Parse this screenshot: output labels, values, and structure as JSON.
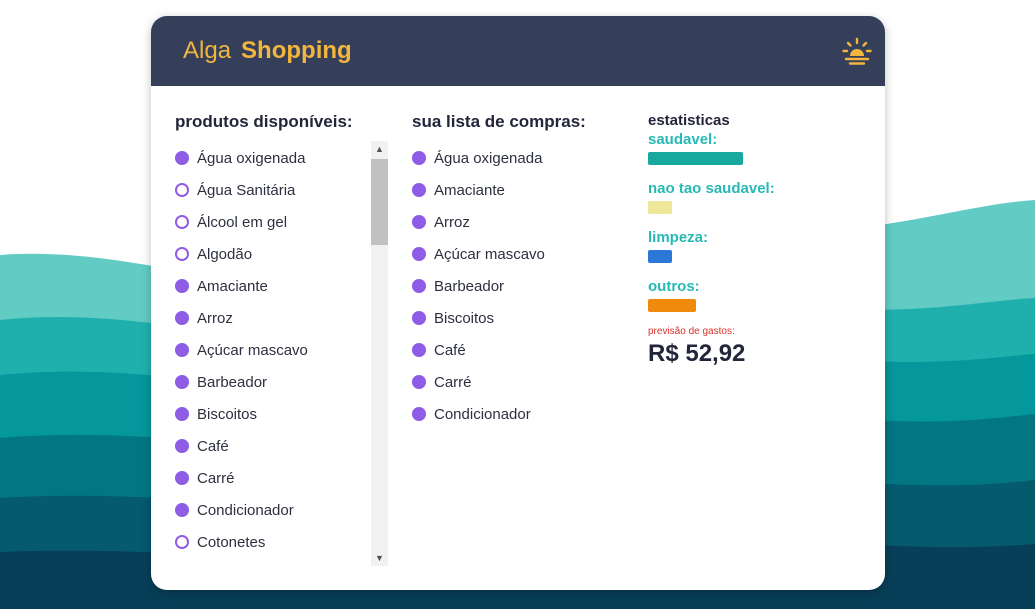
{
  "header": {
    "brand_light": "Alga",
    "brand_bold": "Shopping",
    "theme_icon": "sun-icon"
  },
  "available": {
    "title": "produtos disponíveis:",
    "items": [
      {
        "label": "Água oxigenada",
        "selected": true
      },
      {
        "label": "Água Sanitária",
        "selected": false
      },
      {
        "label": "Álcool em gel",
        "selected": false
      },
      {
        "label": "Algodão",
        "selected": false
      },
      {
        "label": "Amaciante",
        "selected": true
      },
      {
        "label": "Arroz",
        "selected": true
      },
      {
        "label": "Açúcar mascavo",
        "selected": true
      },
      {
        "label": "Barbeador",
        "selected": true
      },
      {
        "label": "Biscoitos",
        "selected": true
      },
      {
        "label": "Café",
        "selected": true
      },
      {
        "label": "Carré",
        "selected": true
      },
      {
        "label": "Condicionador",
        "selected": true
      },
      {
        "label": "Cotonetes",
        "selected": false
      }
    ]
  },
  "shopping_list": {
    "title": "sua lista de compras:",
    "items": [
      {
        "label": "Água oxigenada"
      },
      {
        "label": "Amaciante"
      },
      {
        "label": "Arroz"
      },
      {
        "label": "Açúcar mascavo"
      },
      {
        "label": "Barbeador"
      },
      {
        "label": "Biscoitos"
      },
      {
        "label": "Café"
      },
      {
        "label": "Carré"
      },
      {
        "label": "Condicionador"
      }
    ]
  },
  "stats": {
    "title": "estatisticas",
    "categories": [
      {
        "label": "saudavel:",
        "color": "#17a89e",
        "level": 0.95
      },
      {
        "label": "nao tao saudavel:",
        "color": "#efe79a",
        "level": 0.24
      },
      {
        "label": "limpeza:",
        "color": "#2a79d6",
        "level": 0.24
      },
      {
        "label": "outros:",
        "color": "#ef8a0c",
        "level": 0.48
      }
    ],
    "forecast_label": "previsão de gastos:",
    "forecast_value": "R$ 52,92"
  },
  "colors": {
    "header_bg": "#353f59",
    "brand": "#f2b63f",
    "accent_purple": "#8f5ce6",
    "stat_label": "#27b9b4"
  }
}
